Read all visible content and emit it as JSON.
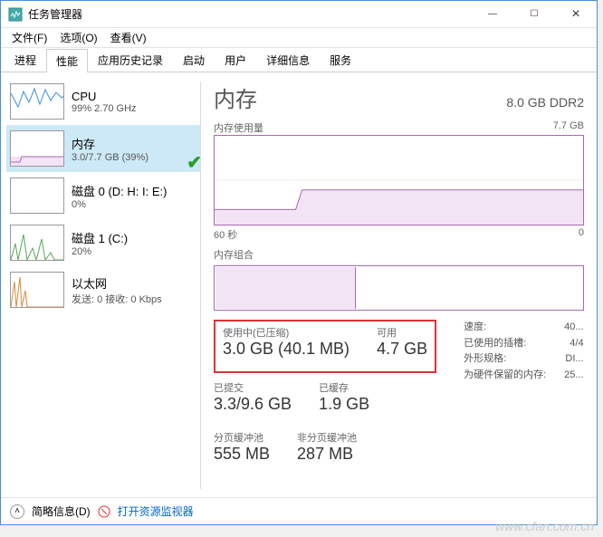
{
  "window": {
    "title": "任务管理器"
  },
  "menu": {
    "file": "文件(F)",
    "options": "选项(O)",
    "view": "查看(V)"
  },
  "tabs": {
    "processes": "进程",
    "performance": "性能",
    "apphistory": "应用历史记录",
    "startup": "启动",
    "users": "用户",
    "details": "详细信息",
    "services": "服务"
  },
  "sidebar": [
    {
      "title": "CPU",
      "sub": "99%  2.70 GHz",
      "color": "#3a8de0"
    },
    {
      "title": "内存",
      "sub": "3.0/7.7 GB (39%)",
      "color": "#a968b5"
    },
    {
      "title": "磁盘 0 (D: H: I: E:)",
      "sub": "0%",
      "color": "#5aa65a"
    },
    {
      "title": "磁盘 1 (C:)",
      "sub": "20%",
      "color": "#5aa65a"
    },
    {
      "title": "以太网",
      "sub": "发送: 0  接收: 0 Kbps",
      "color": "#d88b3a"
    }
  ],
  "main": {
    "title": "内存",
    "capacity": "8.0 GB DDR2",
    "chart1_label_left": "内存使用量",
    "chart1_label_right": "7.7 GB",
    "chart1_x_left": "60 秒",
    "chart1_x_right": "0",
    "chart2_label": "内存组合",
    "stats": {
      "in_use_label": "使用中(已压缩)",
      "in_use_value": "3.0 GB (40.1 MB)",
      "available_label": "可用",
      "available_value": "4.7 GB",
      "committed_label": "已提交",
      "committed_value": "3.3/9.6 GB",
      "cached_label": "已缓存",
      "cached_value": "1.9 GB",
      "paged_label": "分页缓冲池",
      "paged_value": "555 MB",
      "nonpaged_label": "非分页缓冲池",
      "nonpaged_value": "287 MB"
    },
    "kv": {
      "speed_label": "速度:",
      "speed_value": "40...",
      "slots_label": "已使用的插槽:",
      "slots_value": "4/4",
      "form_label": "外形规格:",
      "form_value": "DI...",
      "reserved_label": "为硬件保留的内存:",
      "reserved_value": "25..."
    }
  },
  "footer": {
    "brief": "简略信息(D)",
    "link": "打开资源监视器"
  },
  "watermark": "www.cfan.com.cn",
  "chart_data": {
    "type": "area",
    "title": "内存使用量",
    "ylim": [
      0,
      7.7
    ],
    "ylabel": "GB",
    "xlabel": "秒",
    "xrange": [
      60,
      0
    ],
    "series": [
      {
        "name": "Memory",
        "approx_level": 3.0,
        "step_at_fraction": 0.22,
        "before_step": 1.3
      }
    ]
  }
}
